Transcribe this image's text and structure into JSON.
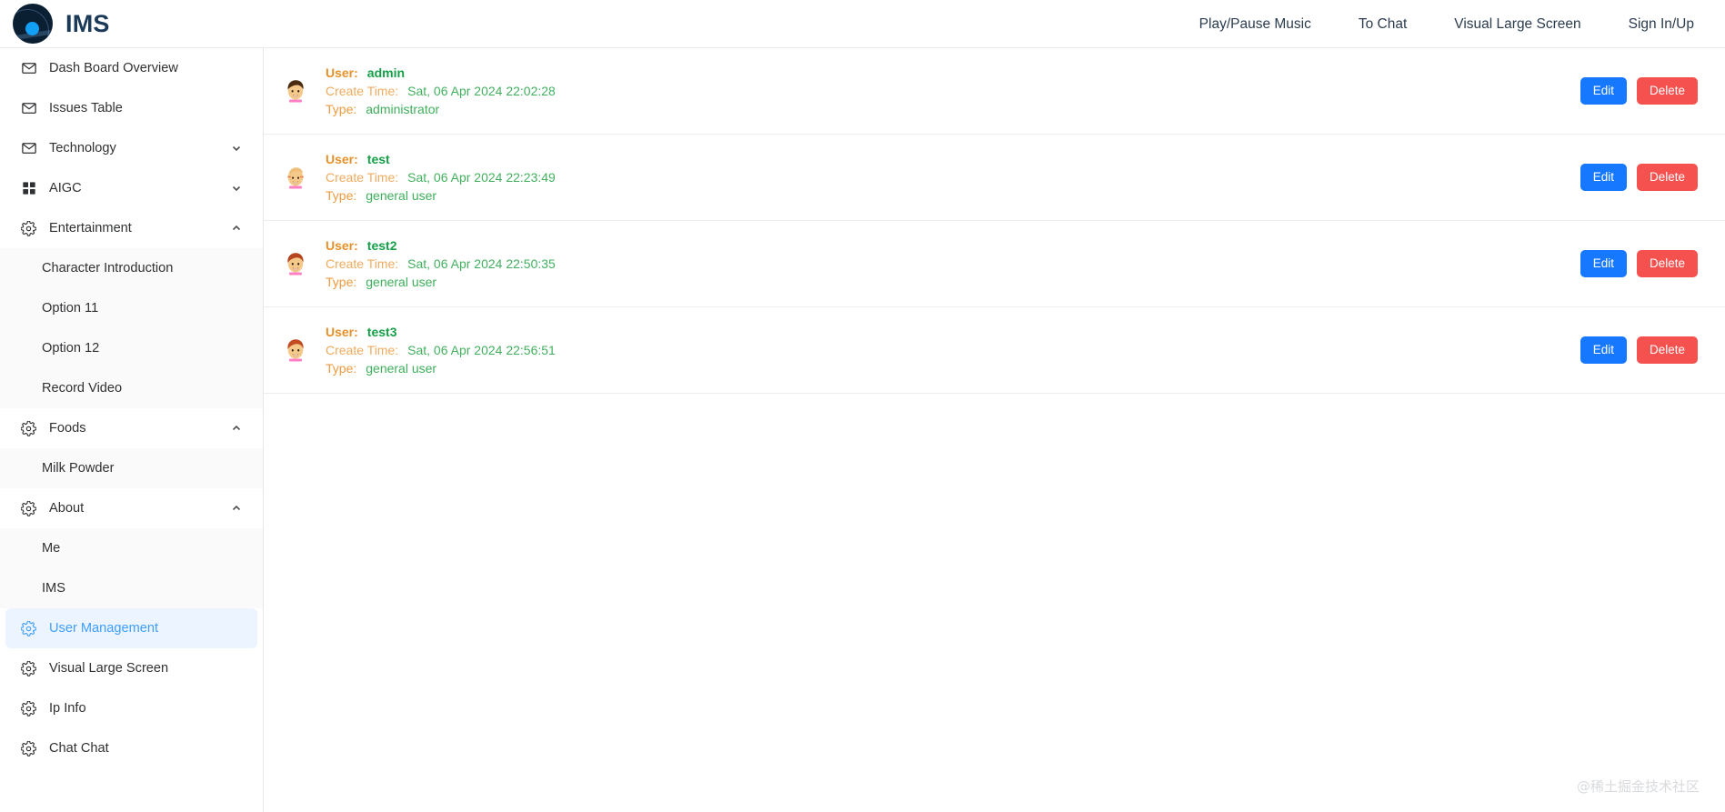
{
  "header": {
    "brand_title": "IMS",
    "logo_icon": "ims-logo-icon",
    "nav": [
      {
        "label": "Play/Pause Music",
        "name": "nav-play-pause-music"
      },
      {
        "label": "To Chat",
        "name": "nav-to-chat"
      },
      {
        "label": "Visual Large Screen",
        "name": "nav-visual-large-screen"
      },
      {
        "label": "Sign In/Up",
        "name": "nav-sign-in-up"
      }
    ]
  },
  "sidebar": {
    "items": [
      {
        "label": "Dash Board Overview",
        "icon": "mail-icon",
        "type": "item"
      },
      {
        "label": "Issues Table",
        "icon": "mail-icon",
        "type": "item"
      },
      {
        "label": "Technology",
        "icon": "mail-icon",
        "type": "group",
        "expanded": false,
        "arrow": "chevron-down-icon"
      },
      {
        "label": "AIGC",
        "icon": "grid-icon",
        "type": "group",
        "expanded": false,
        "arrow": "chevron-down-icon"
      },
      {
        "label": "Entertainment",
        "icon": "gear-icon",
        "type": "group",
        "expanded": true,
        "arrow": "chevron-up-icon"
      },
      {
        "label": "Character Introduction",
        "type": "sub"
      },
      {
        "label": "Option 11",
        "type": "sub"
      },
      {
        "label": "Option 12",
        "type": "sub"
      },
      {
        "label": "Record Video",
        "type": "sub"
      },
      {
        "label": "Foods",
        "icon": "gear-icon",
        "type": "group",
        "expanded": true,
        "arrow": "chevron-up-icon"
      },
      {
        "label": "Milk Powder",
        "type": "sub"
      },
      {
        "label": "About",
        "icon": "gear-icon",
        "type": "group",
        "expanded": true,
        "arrow": "chevron-up-icon"
      },
      {
        "label": "Me",
        "type": "sub"
      },
      {
        "label": "IMS",
        "type": "sub"
      },
      {
        "label": "User Management",
        "icon": "gear-icon",
        "type": "item",
        "active": true
      },
      {
        "label": "Visual Large Screen",
        "icon": "gear-icon",
        "type": "item"
      },
      {
        "label": "Ip Info",
        "icon": "gear-icon",
        "type": "item"
      },
      {
        "label": "Chat Chat",
        "icon": "gear-icon",
        "type": "item"
      }
    ],
    "active_label": "User Management",
    "active_color": "#409eff",
    "active_bg": "#ecf5ff"
  },
  "main": {
    "labels": {
      "user": "User:",
      "create_time": "Create Time:",
      "type": "Type:"
    },
    "buttons": {
      "edit": "Edit",
      "delete": "Delete",
      "edit_color": "#1677ff",
      "delete_color": "#f5524f"
    },
    "rows": [
      {
        "user": "admin",
        "create_time": "Sat, 06 Apr 2024 22:02:28",
        "type": "administrator",
        "avatar": "avatar-dark-brown-hair"
      },
      {
        "user": "test",
        "create_time": "Sat, 06 Apr 2024 22:23:49",
        "type": "general user",
        "avatar": "avatar-bald-blond"
      },
      {
        "user": "test2",
        "create_time": "Sat, 06 Apr 2024 22:50:35",
        "type": "general user",
        "avatar": "avatar-red-hair"
      },
      {
        "user": "test3",
        "create_time": "Sat, 06 Apr 2024 22:56:51",
        "type": "general user",
        "avatar": "avatar-red-hair-2"
      }
    ]
  },
  "watermark": {
    "text": "@稀土掘金技术社区"
  }
}
